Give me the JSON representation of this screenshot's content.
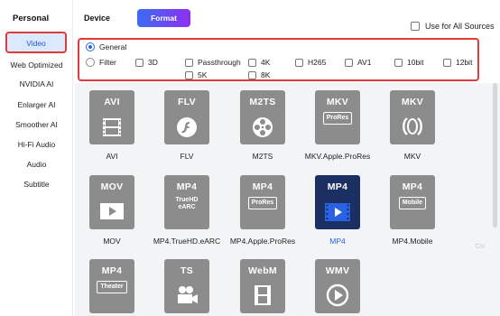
{
  "sidebar": {
    "header": "Personal",
    "items": [
      {
        "label": "Video"
      },
      {
        "label": "Web Optimized"
      },
      {
        "label": "NVIDIA AI"
      },
      {
        "label": "Enlarger AI"
      },
      {
        "label": "Smoother AI"
      },
      {
        "label": "Hi-Fi Audio"
      },
      {
        "label": "Audio"
      },
      {
        "label": "Subtitle"
      }
    ]
  },
  "tabs": {
    "device": "Device",
    "format": "Format"
  },
  "use_all": {
    "label": "Use for All Sources"
  },
  "filter": {
    "general": "General",
    "filter": "Filter",
    "options": [
      "3D",
      "Passthrough",
      "4K",
      "H265",
      "AV1",
      "10bit",
      "12bit",
      "5K",
      "8K"
    ]
  },
  "formats": [
    {
      "code": "AVI",
      "sub": "",
      "label": "AVI"
    },
    {
      "code": "FLV",
      "sub": "",
      "label": "FLV"
    },
    {
      "code": "M2TS",
      "sub": "",
      "label": "M2TS"
    },
    {
      "code": "MKV",
      "sub": "ProRes",
      "label": "MKV.Apple.ProRes"
    },
    {
      "code": "MKV",
      "sub": "",
      "label": "MKV"
    },
    {
      "code": "MOV",
      "sub": "",
      "label": "MOV"
    },
    {
      "code": "MP4",
      "sub": "TrueHD eARC",
      "label": "MP4.TrueHD.eARC"
    },
    {
      "code": "MP4",
      "sub": "ProRes",
      "label": "MP4.Apple.ProRes"
    },
    {
      "code": "MP4",
      "sub": "",
      "label": "MP4"
    },
    {
      "code": "MP4",
      "sub": "Mobile",
      "label": "MP4.Mobile"
    },
    {
      "code": "MP4",
      "sub": "Theater",
      "label": ""
    },
    {
      "code": "TS",
      "sub": "",
      "label": ""
    },
    {
      "code": "WebM",
      "sub": "",
      "label": ""
    },
    {
      "code": "WMV",
      "sub": "",
      "label": ""
    }
  ],
  "ghost_text": "CN",
  "colors": {
    "accent": "#2a62e6",
    "highlight": "#e03b3b",
    "tile": "#8c8c8c",
    "tile_selected": "#1b2f62"
  }
}
